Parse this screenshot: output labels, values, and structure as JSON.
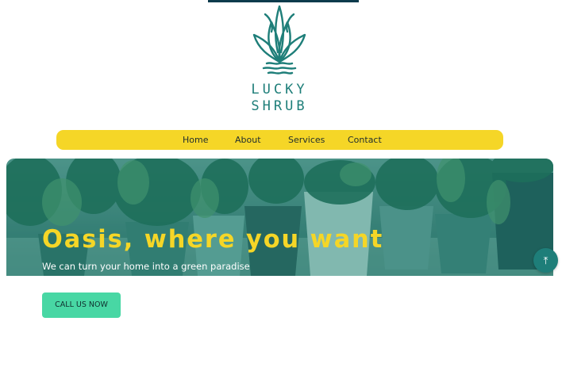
{
  "brand": {
    "name_line1": "LUCKY",
    "name_line2": "SHRUB",
    "logo_icon": "potted-plant-icon",
    "color": "#1e7e79"
  },
  "nav": {
    "items": [
      {
        "label": "Home"
      },
      {
        "label": "About"
      },
      {
        "label": "Services"
      },
      {
        "label": "Contact"
      }
    ],
    "background": "#f5d627"
  },
  "hero": {
    "title": "Oasis, where you want",
    "subtitle": "We can turn your home into a green paradise",
    "title_color": "#f5d627",
    "overlay_color": "#1e7e79"
  },
  "cta": {
    "label": "CALL US NOW",
    "color": "#48d7a4"
  },
  "scroll_top": {
    "icon": "arrow-up-icon",
    "glyph": "⤒"
  }
}
